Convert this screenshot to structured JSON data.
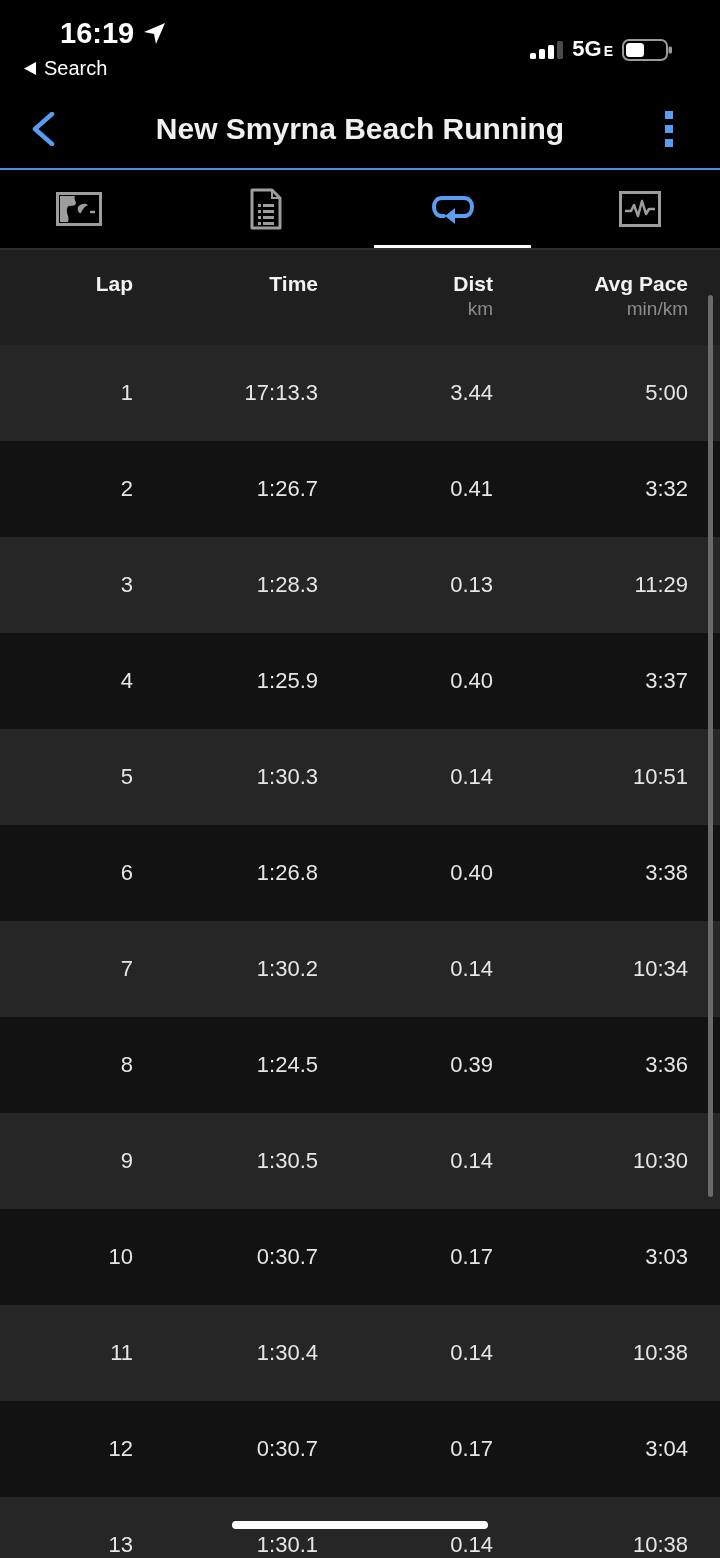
{
  "status_bar": {
    "time": "16:19",
    "back_link": "Search",
    "network": "5GE"
  },
  "nav_bar": {
    "title": "New Smyrna Beach Running"
  },
  "tabs": [
    {
      "kind": "map",
      "selected": false
    },
    {
      "kind": "details",
      "selected": false
    },
    {
      "kind": "laps",
      "selected": true
    },
    {
      "kind": "charts",
      "selected": false
    }
  ],
  "table": {
    "columns": [
      {
        "label": "Lap"
      },
      {
        "label": "Time"
      },
      {
        "label": "Dist",
        "unit": "km"
      },
      {
        "label": "Avg Pace",
        "unit": "min/km"
      }
    ],
    "rows": [
      [
        "1",
        "17:13.3",
        "3.44",
        "5:00"
      ],
      [
        "2",
        "1:26.7",
        "0.41",
        "3:32"
      ],
      [
        "3",
        "1:28.3",
        "0.13",
        "11:29"
      ],
      [
        "4",
        "1:25.9",
        "0.40",
        "3:37"
      ],
      [
        "5",
        "1:30.3",
        "0.14",
        "10:51"
      ],
      [
        "6",
        "1:26.8",
        "0.40",
        "3:38"
      ],
      [
        "7",
        "1:30.2",
        "0.14",
        "10:34"
      ],
      [
        "8",
        "1:24.5",
        "0.39",
        "3:36"
      ],
      [
        "9",
        "1:30.5",
        "0.14",
        "10:30"
      ],
      [
        "10",
        "0:30.7",
        "0.17",
        "3:03"
      ],
      [
        "11",
        "1:30.4",
        "0.14",
        "10:38"
      ],
      [
        "12",
        "0:30.7",
        "0.17",
        "3:04"
      ],
      [
        "13",
        "1:30.1",
        "0.14",
        "10:38"
      ]
    ]
  }
}
